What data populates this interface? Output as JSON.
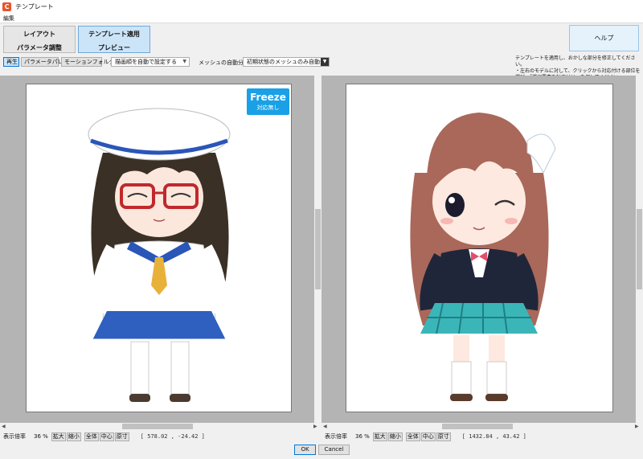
{
  "window": {
    "title": "テンプレート"
  },
  "menu": {
    "edit": "編集"
  },
  "modes": [
    {
      "top": "レイアウト",
      "bottom": "パラメータ調整",
      "active": false
    },
    {
      "top": "テンプレート適用",
      "bottom": "プレビュー",
      "active": true
    }
  ],
  "help": {
    "label": "ヘルプ"
  },
  "toolbar": {
    "play": "再生",
    "param_palette": "パラメータパレット",
    "motion_folder": "モーションフォルダ",
    "draw_order_combo": "描画順を自動で設定する",
    "mesh_label": "メッシュの自動分割",
    "mesh_combo": "初期状態のメッシュのみ自動分割"
  },
  "instructions": "テンプレートを適用し、おかしな部分を修正してください。\n・左右のモデルに対して、クリックから対応付ける部位を選び、「選択要素を対応付け」を押してください。",
  "freeze_badge": {
    "title": "Freeze",
    "subtitle": "対応無し"
  },
  "left_status": {
    "zoom_label": "表示倍率",
    "zoom_value": "36 %",
    "zoom_in": "拡大",
    "zoom_out": "縮小",
    "fit": "全体",
    "center": "中心",
    "actual": "原寸",
    "coords": "[  578.02 ,  -24.42 ]"
  },
  "right_status": {
    "zoom_label": "表示倍率",
    "zoom_value": "36 %",
    "zoom_in": "拡大",
    "zoom_out": "縮小",
    "fit": "全体",
    "center": "中心",
    "actual": "原寸",
    "coords": "[  1432.84 ,   43.42 ]"
  },
  "dialog": {
    "ok": "OK",
    "cancel": "Cancel"
  },
  "colors": {
    "accent": "#0078d7",
    "freeze": "#1aa0e6",
    "viewport": "#b4b4b4"
  }
}
